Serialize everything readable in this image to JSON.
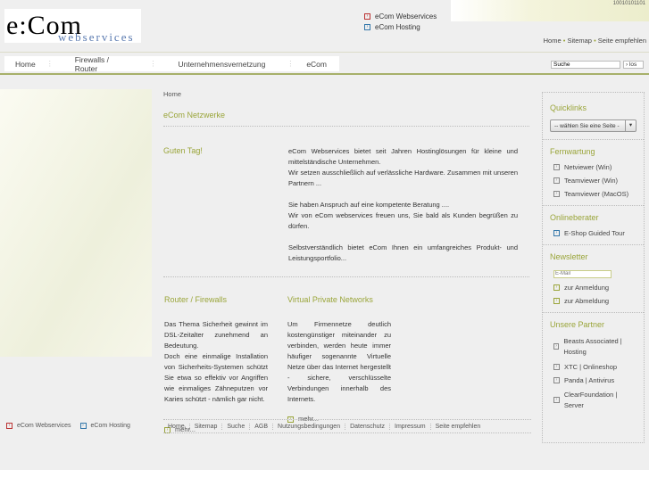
{
  "header": {
    "logo_text": "e:Com",
    "logo_sub": "webservices",
    "links": [
      {
        "label": "eCom Webservices"
      },
      {
        "label": "eCom Hosting"
      }
    ],
    "top_nav": [
      "Home",
      "Sitemap",
      "Seite empfehlen"
    ],
    "image_text": "10010101101"
  },
  "nav": {
    "items": [
      "Home",
      "Firewalls / Router",
      "Unternehmensvernetzung",
      "eCom"
    ]
  },
  "search": {
    "value": "Suche",
    "button": "› los"
  },
  "main": {
    "breadcrumb": "Home",
    "title": "eCom Netzwerke",
    "greeting": "Guten Tag!",
    "intro": [
      "eCom Webservices bietet seit Jahren Hostinglösungen für kleine und mittelständische Unternehmen.",
      "Wir setzen ausschließlich auf verlässliche Hardware. Zusammen mit unseren Partnern ...",
      "Sie haben Anspruch auf eine kompetente Beratung ....",
      "Wir von eCom webservices freuen uns, Sie bald als Kunden begrüßen zu dürfen.",
      "Selbstverständlich bietet eCom Ihnen ein umfangreiches Produkt- und Leistungsportfolio..."
    ],
    "cols": [
      {
        "title": "Router / Firewalls",
        "text1": "Das Thema Sicherheit gewinnt im DSL-Zeitalter zunehmend an Bedeutung.",
        "text2": "Doch eine einmalige Installation von Sicherheits-Systemen schützt Sie etwa so effektiv vor Angriffen wie einmaliges Zähneputzen vor Karies schützt - nämlich gar nicht.",
        "more": "mehr..."
      },
      {
        "title": "Virtual Private Networks",
        "text1": "Um Firmennetze deutlich kostengünstiger miteinander zu verbinden, werden heute immer häufiger sogenannte Virtuelle Netze über das Internet hergestellt - sichere, verschlüsselte Verbindungen innerhalb des Internets.",
        "text2": "",
        "more": "mehr..."
      }
    ]
  },
  "sidebar": {
    "quicklinks": {
      "title": "Quicklinks",
      "select": "-- wählen Sie eine Seite -"
    },
    "fernwartung": {
      "title": "Fernwartung",
      "items": [
        "Netviewer (Win)",
        "Teamviewer (Win)",
        "Teamviewer (MacOS)"
      ]
    },
    "onlineberater": {
      "title": "Onlineberater",
      "items": [
        "E-Shop Guided Tour"
      ]
    },
    "newsletter": {
      "title": "Newsletter",
      "placeholder": "E-Mail",
      "items": [
        "zur Anmeldung",
        "zur Abmeldung"
      ]
    },
    "partner": {
      "title": "Unsere Partner",
      "items": [
        "Beasts Associated | Hosting",
        "XTC | Onlineshop",
        "Panda | Antivirus",
        "ClearFoundation | Server"
      ]
    }
  },
  "footer": {
    "left": [
      "eCom Webservices",
      "eCom Hosting"
    ],
    "links": [
      "Home",
      "Sitemap",
      "Suche",
      "AGB",
      "Nutzungsbedingungen",
      "Datenschutz",
      "Impressum",
      "Seite empfehlen"
    ]
  }
}
